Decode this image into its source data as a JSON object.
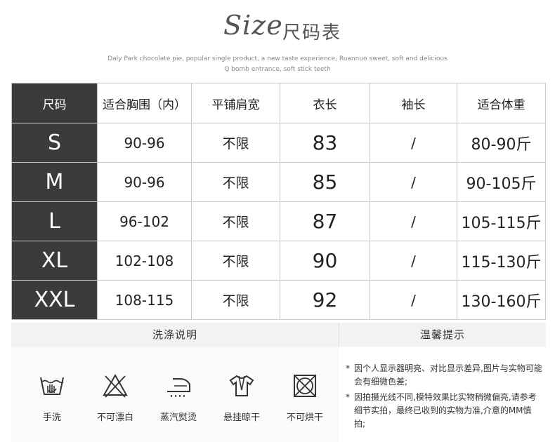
{
  "header": {
    "title_script": "Size",
    "title_cn": "尺码表",
    "subtitle_line1": "Daly Park chocolate pie, popular single product, a new taste experience, Ruannuo sweet, soft and delicious",
    "subtitle_line2": "Q bomb entrance, soft stick teeth"
  },
  "table": {
    "headers": [
      "尺码",
      "适合胸围（内）",
      "平铺肩宽",
      "衣长",
      "袖长",
      "适合体重"
    ],
    "rows": [
      {
        "size": "S",
        "chest": "90-96",
        "shoulder": "不限",
        "length": "83",
        "sleeve": "/",
        "weight": "80-90斤"
      },
      {
        "size": "M",
        "chest": "90-96",
        "shoulder": "不限",
        "length": "85",
        "sleeve": "/",
        "weight": "90-105斤"
      },
      {
        "size": "L",
        "chest": "96-102",
        "shoulder": "不限",
        "length": "87",
        "sleeve": "/",
        "weight": "105-115斤"
      },
      {
        "size": "XL",
        "chest": "102-108",
        "shoulder": "不限",
        "length": "90",
        "sleeve": "/",
        "weight": "115-130斤"
      },
      {
        "size": "XXL",
        "chest": "108-115",
        "shoulder": "不限",
        "length": "92",
        "sleeve": "/",
        "weight": "130-160斤"
      }
    ]
  },
  "care": {
    "title": "洗涤说明",
    "items": [
      {
        "label": "手洗",
        "icon": "hand-wash-icon"
      },
      {
        "label": "不可漂白",
        "icon": "no-bleach-icon"
      },
      {
        "label": "蒸汽熨烫",
        "icon": "steam-iron-icon"
      },
      {
        "label": "悬挂晾干",
        "icon": "hang-dry-icon"
      },
      {
        "label": "不可烘干",
        "icon": "no-tumble-dry-icon"
      }
    ]
  },
  "tips": {
    "title": "温馨提示",
    "bullet": "*",
    "items": [
      "因个人显示器明亮、对比显示差异,图片与实物可能会有细微色差;",
      "因拍摄光线不同,模特效果比实物稍微偏亮,请参考细节实拍，最终已收到的实物为准,介意的MM慎拍;"
    ]
  },
  "colors": {
    "dark_cell": "#3b3b3b",
    "border": "#c9c9c9"
  }
}
